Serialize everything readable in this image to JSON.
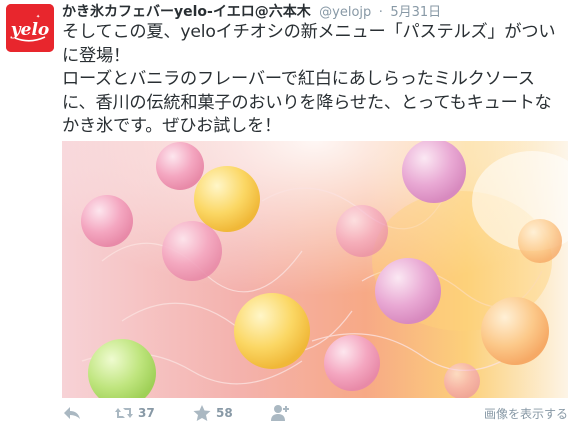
{
  "tweet": {
    "avatar_text": "yelo",
    "display_name": "かき氷カフェバーyelo-イエロ@六本木",
    "screen_name": "@yelojp",
    "separator": "·",
    "timestamp": "5月31日",
    "text_lines": [
      "そしてこの夏、yeloイチオシの新メニュー「パステルズ」がついに登場！",
      "ローズとバニラのフレーバーで紅白にあしらったミルクソースに、香川の伝統和菓子のおいりを降らせた、とってもキュートなかき氷です。ぜひお試しを！"
    ]
  },
  "actions": {
    "reply_icon": "reply-icon",
    "retweet_icon": "retweet-icon",
    "retweet_count": "37",
    "favorite_icon": "star-icon",
    "favorite_count": "58",
    "follow_icon": "add-user-icon",
    "view_media_label": "画像を表示する"
  },
  "colors": {
    "name": "#292f33",
    "meta": "#8899a6",
    "action_icon": "#aab8c2",
    "avatar_bg": "#e8262d"
  }
}
